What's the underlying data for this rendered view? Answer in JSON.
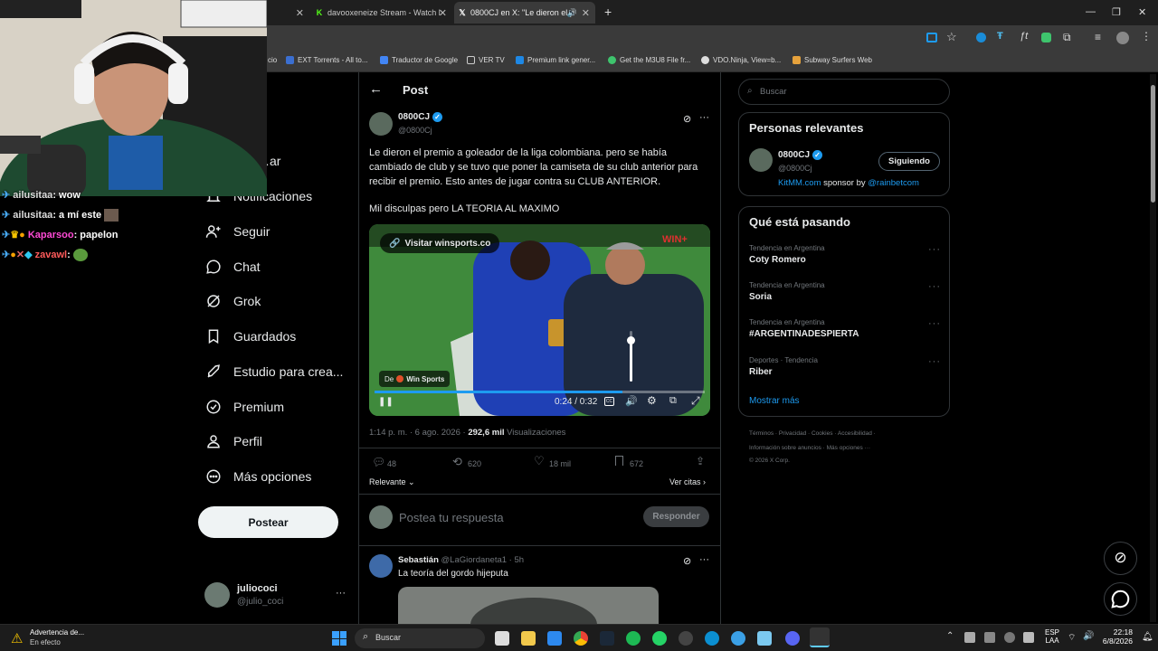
{
  "browser": {
    "tabs": [
      {
        "title": "davooxeneize Stream - Watch l"
      },
      {
        "title": "0800CJ en X: \"Le dieron el p"
      }
    ],
    "bookmarks": [
      "cio",
      "EXT Torrents - All to...",
      "Traductor de Google",
      "VER TV",
      "Premium link gener...",
      "Get the M3U8 File fr...",
      "VDO.Ninja, View=b...",
      "Subway Surfers Web"
    ]
  },
  "stream_chat": [
    {
      "user": "ailusitaa",
      "msg": "wow"
    },
    {
      "user": "ailusitaa",
      "msg": "a mí este"
    },
    {
      "user": "Kaparsoo",
      "msg": "papelon"
    },
    {
      "user": "zavawl",
      "msg": ""
    }
  ],
  "sidebar": {
    "items": [
      {
        "label": "…ar",
        "icon": "search-icon"
      },
      {
        "label": "Notificaciones",
        "icon": "bell-icon"
      },
      {
        "label": "Seguir",
        "icon": "follow-icon"
      },
      {
        "label": "Chat",
        "icon": "chat-icon"
      },
      {
        "label": "Grok",
        "icon": "grok-icon"
      },
      {
        "label": "Guardados",
        "icon": "bookmark-icon"
      },
      {
        "label": "Estudio para crea...",
        "icon": "rocket-icon"
      },
      {
        "label": "Premium",
        "icon": "premium-icon"
      },
      {
        "label": "Perfil",
        "icon": "profile-icon"
      },
      {
        "label": "Más opciones",
        "icon": "more-icon"
      }
    ],
    "post_button": "Postear",
    "account": {
      "name": "juliococi",
      "handle": "@julio_coci"
    }
  },
  "post": {
    "header": "Post",
    "author_name": "0800CJ",
    "author_handle": "@0800Cj",
    "text_1": "Le dieron el premio a goleador de la liga colombiana. pero se había cambiado de club y se tuvo que poner la camiseta de su club anterior para recibir el premio. Esto antes de jugar contra su CLUB ANTERIOR.",
    "text_2": "Mil disculpas pero LA TEORIA AL MAXIMO",
    "video": {
      "link_label": "Visitar winsports.co",
      "source_prefix": "De",
      "source_name": "Win Sports",
      "time": "0:24 / 0:32",
      "progress": 0.75,
      "volume": 0.8,
      "watermark": "WIN+"
    },
    "meta_time": "1:14 p. m. · 6 ago. 2026 ·",
    "views_count": "292,6 mil",
    "views_label": "Visualizaciones",
    "actions": {
      "replies": "48",
      "reposts": "620",
      "likes": "18 mil",
      "bookmarks": "672"
    },
    "sort_label": "Relevante",
    "quotes_label": "Ver citas",
    "reply_placeholder": "Postea tu respuesta",
    "reply_button": "Responder"
  },
  "reply": {
    "author_name": "Sebastián",
    "author_handle": "@LaGiordaneta1 · 5h",
    "text": "La teoría del gordo hijeputa"
  },
  "right": {
    "search_placeholder": "Buscar",
    "relevant_title": "Personas relevantes",
    "relevant_name": "0800CJ",
    "relevant_handle": "@0800Cj",
    "follow_button": "Siguiendo",
    "bio_link": "KitMM.com",
    "bio_mid": "sponsor by",
    "bio_mention": "@rainbetcom",
    "trends_title": "Qué está pasando",
    "trends": [
      {
        "category": "Tendencia en Argentina",
        "name": "Coty Romero"
      },
      {
        "category": "Tendencia en Argentina",
        "name": "Soria"
      },
      {
        "category": "Tendencia en Argentina",
        "name": "#ARGENTINADESPIERTA"
      },
      {
        "category": "Deportes · Tendencia",
        "name": "Riber"
      }
    ],
    "show_more": "Mostrar más",
    "footer_1": "Términos · Privacidad · Cookies · Accesibilidad ·",
    "footer_2": "Información sobre anuncios · Más opciones ···",
    "footer_3": "© 2026 X Corp."
  },
  "taskbar": {
    "warning_title": "Advertencia de...",
    "warning_sub": "En efecto",
    "search_label": "Buscar",
    "lang": "ESP",
    "lang_sub": "LAA",
    "time": "22:18",
    "date": "6/8/2026"
  },
  "colors": {
    "accent": "#1d9bf0",
    "background": "#000000",
    "border": "#2f3336"
  }
}
